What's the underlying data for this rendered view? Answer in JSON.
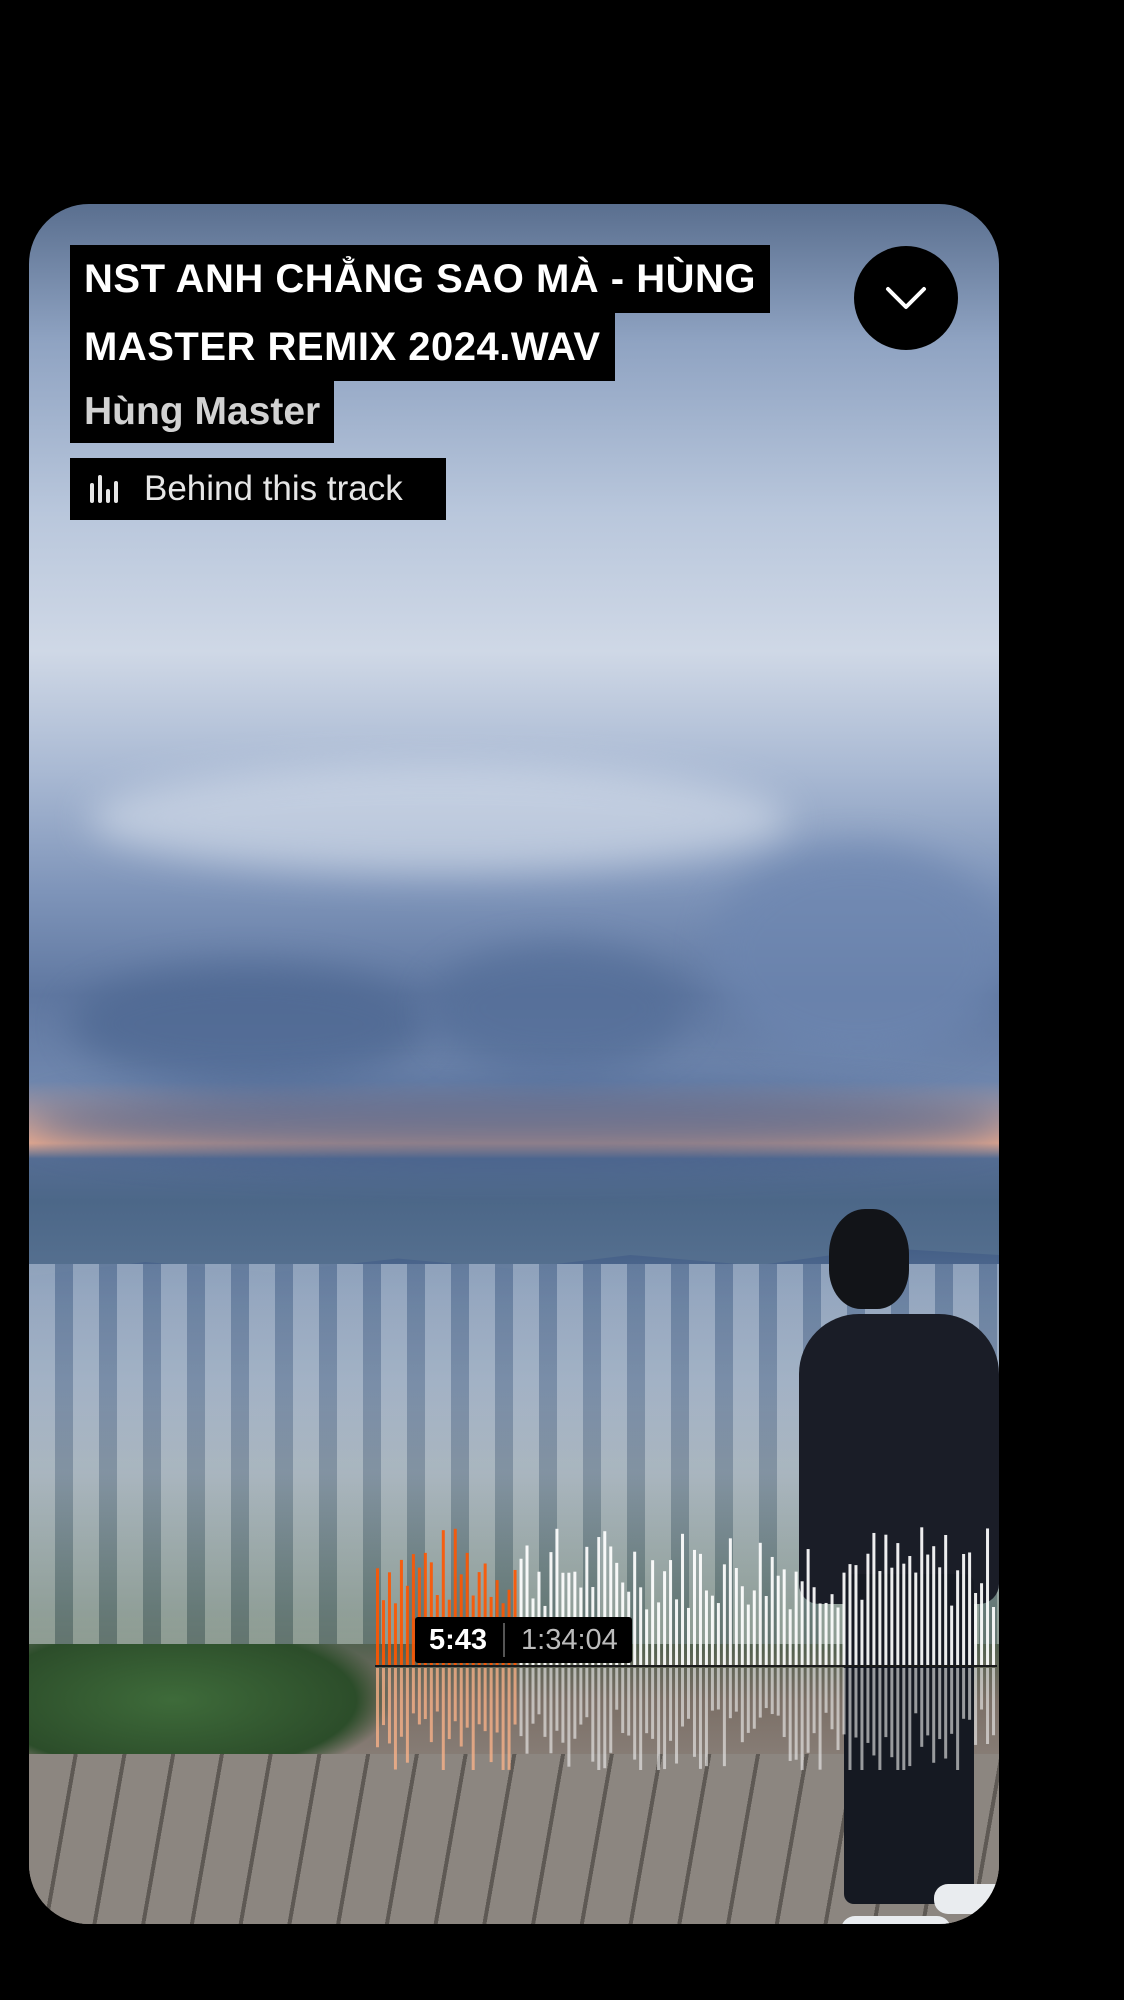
{
  "track": {
    "title_line1": "NST ANH CHẲNG SAO MÀ - HÙNG",
    "title_line2": "MASTER REMIX 2024.WAV",
    "artist": "Hùng Master"
  },
  "behind_track": {
    "label": "Behind this track",
    "icon": "waveform-bars-icon"
  },
  "collapse_button": {
    "icon": "chevron-down-icon"
  },
  "playback": {
    "current_time": "5:43",
    "total_time": "1:34:04",
    "progress_fraction": 0.061,
    "played_color": "#ff5500",
    "unplayed_color": "#ffffff"
  }
}
